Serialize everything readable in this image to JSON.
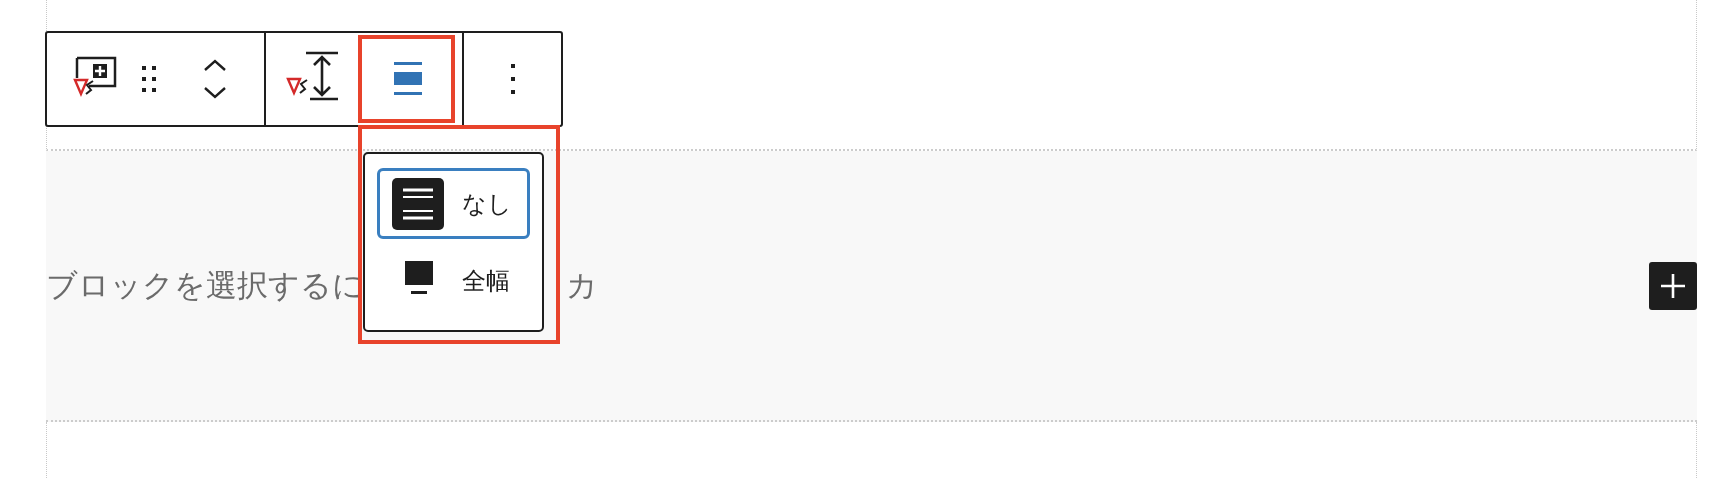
{
  "toolbar": {
    "align_pressed": true
  },
  "align_menu": {
    "items": [
      {
        "label": "なし",
        "kind": "none",
        "selected": true
      },
      {
        "label": "全幅",
        "kind": "full",
        "selected": false
      }
    ]
  },
  "block_hint": [
    "ブロックを選択するに",
    "カ"
  ]
}
